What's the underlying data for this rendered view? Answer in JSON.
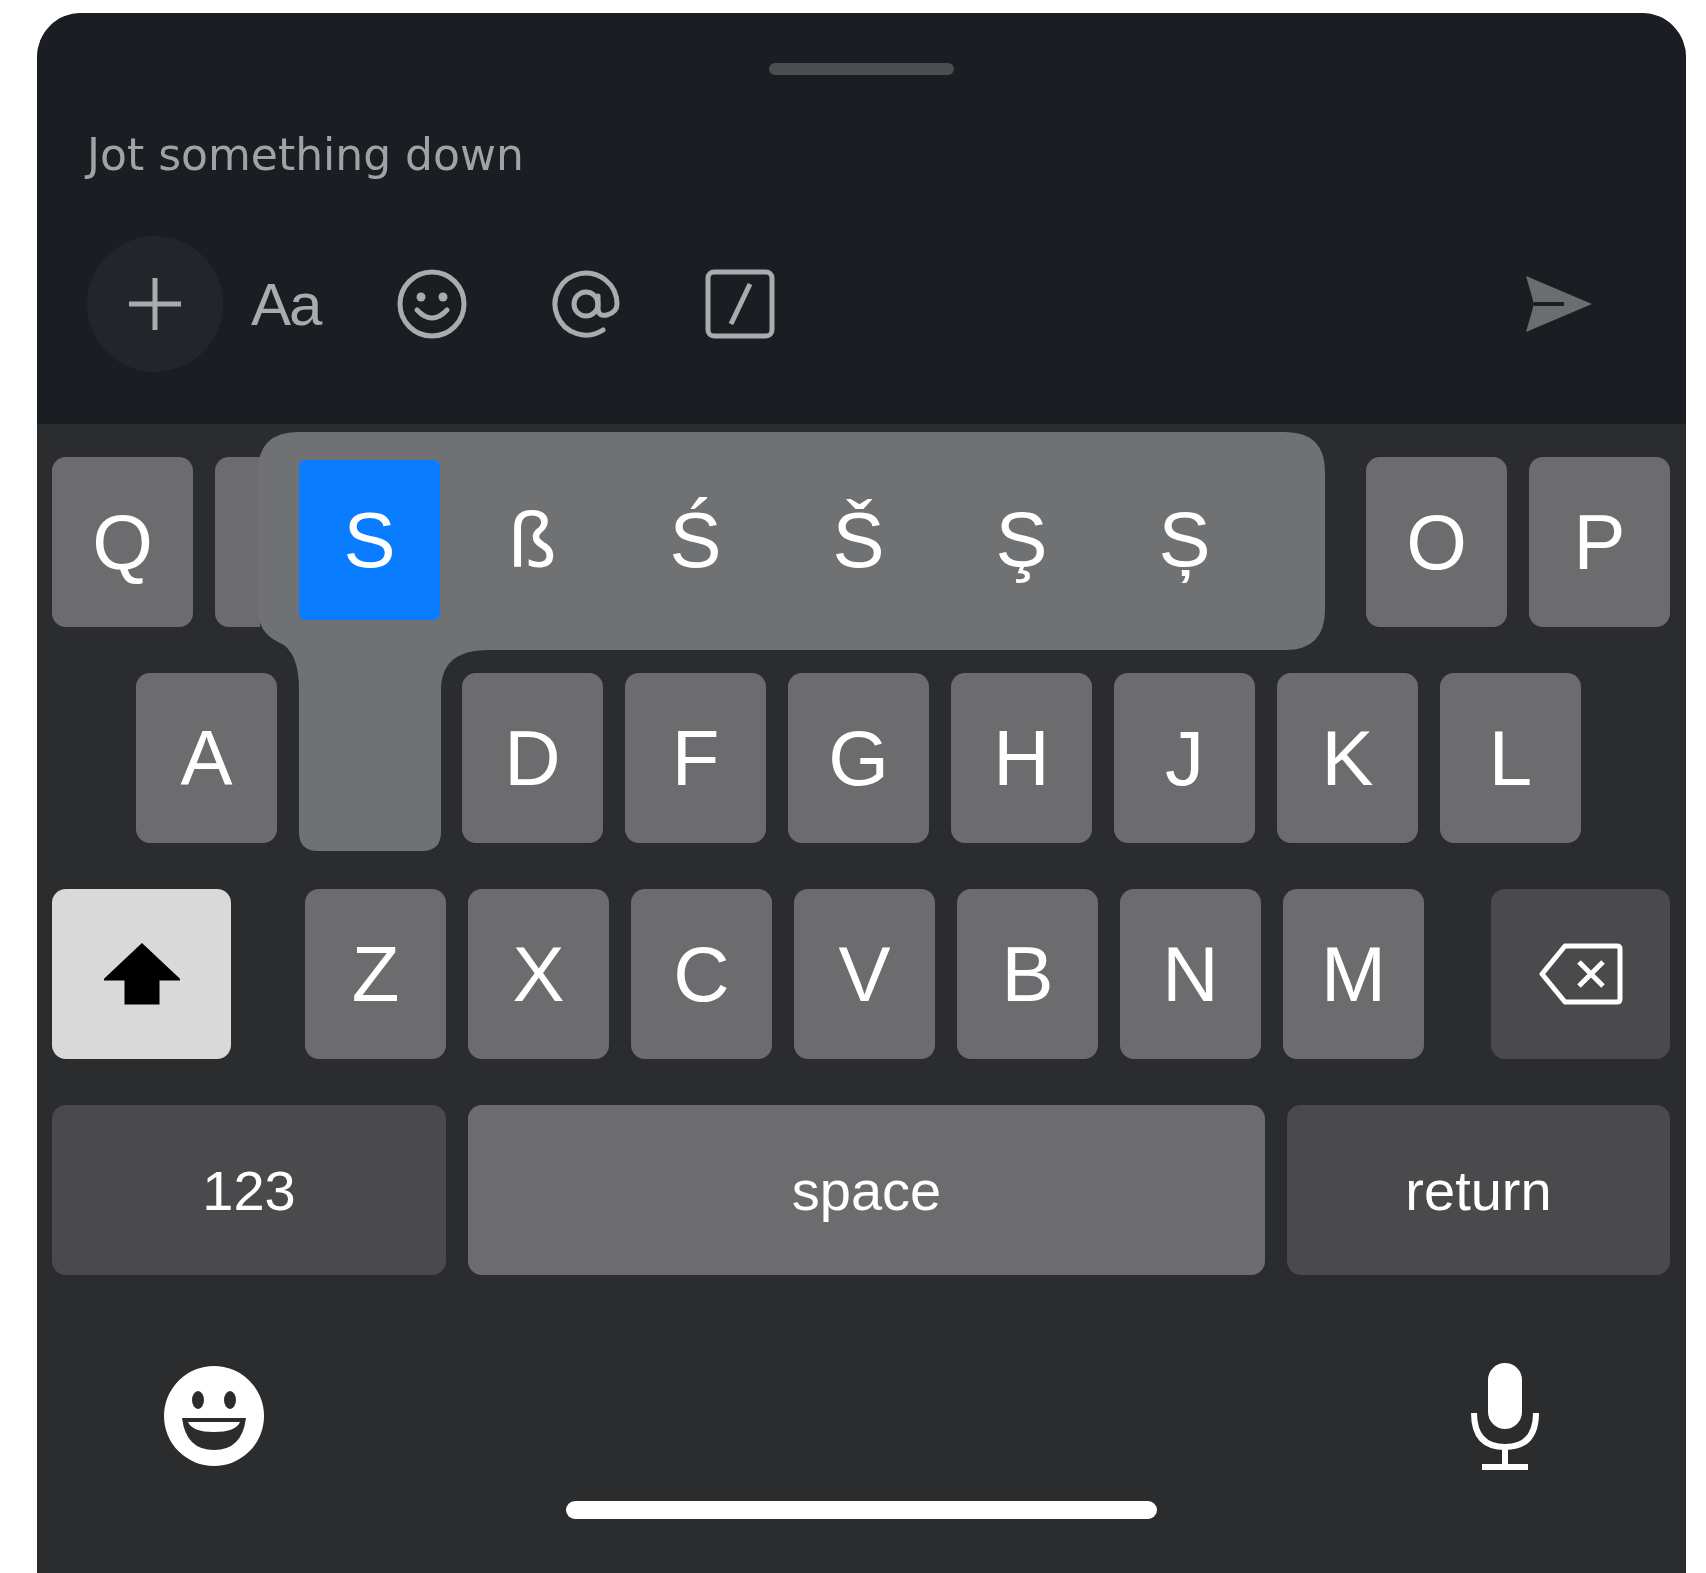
{
  "composer": {
    "placeholder": "Jot something down"
  },
  "toolbar": {
    "format_label": "Aa"
  },
  "keyboard": {
    "rows": [
      {
        "keys": [
          {
            "label": "Q",
            "kind": "letter"
          },
          {
            "kind": "edge"
          },
          {
            "label": "O",
            "kind": "letter"
          },
          {
            "label": "P",
            "kind": "letter"
          }
        ]
      },
      {
        "keys": [
          {
            "label": "A",
            "kind": "letter"
          },
          {
            "kind": "gap"
          },
          {
            "label": "D",
            "kind": "letter"
          },
          {
            "label": "F",
            "kind": "letter"
          },
          {
            "label": "G",
            "kind": "letter"
          },
          {
            "label": "H",
            "kind": "letter"
          },
          {
            "label": "J",
            "kind": "letter"
          },
          {
            "label": "K",
            "kind": "letter"
          },
          {
            "label": "L",
            "kind": "letter"
          }
        ]
      },
      {
        "keys": [
          {
            "kind": "shift",
            "on": true
          },
          {
            "label": "Z",
            "kind": "letter"
          },
          {
            "label": "X",
            "kind": "letter"
          },
          {
            "label": "C",
            "kind": "letter"
          },
          {
            "label": "V",
            "kind": "letter"
          },
          {
            "label": "B",
            "kind": "letter"
          },
          {
            "label": "N",
            "kind": "letter"
          },
          {
            "label": "M",
            "kind": "letter"
          },
          {
            "kind": "delete"
          }
        ]
      },
      {
        "keys": [
          {
            "label": "123",
            "kind": "numbers"
          },
          {
            "label": "space",
            "kind": "space"
          },
          {
            "label": "return",
            "kind": "return"
          }
        ]
      }
    ],
    "accent_popup": {
      "options": [
        {
          "label": "S",
          "selected": true
        },
        {
          "label": "ß",
          "selected": false
        },
        {
          "label": "Ś",
          "selected": false
        },
        {
          "label": "Š",
          "selected": false
        },
        {
          "label": "Ş",
          "selected": false
        },
        {
          "label": "Ș",
          "selected": false
        }
      ]
    }
  }
}
